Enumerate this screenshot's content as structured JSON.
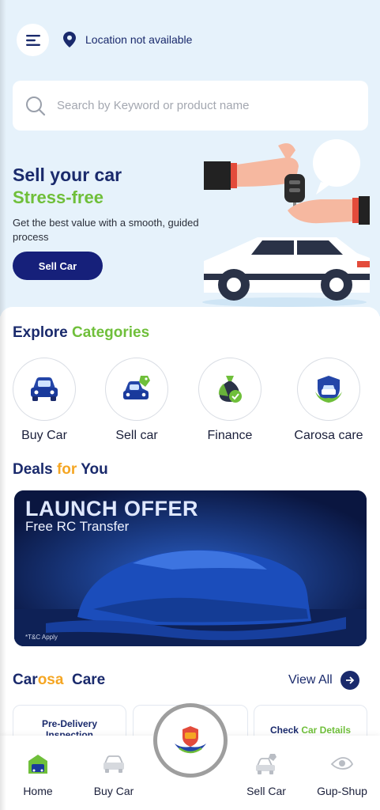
{
  "header": {
    "location_text": "Location not available"
  },
  "search": {
    "placeholder": "Search by Keyword or product name"
  },
  "hero": {
    "title_line1": "Sell your car",
    "title_line2": "Stress-free",
    "description": "Get the best value with a smooth, guided process",
    "button_label": "Sell Car"
  },
  "explore": {
    "title_part1": "Explore",
    "title_part2": "Categories",
    "categories": [
      {
        "label": "Buy Car",
        "icon": "car-front-icon"
      },
      {
        "label": "Sell car",
        "icon": "car-tag-icon"
      },
      {
        "label": "Finance",
        "icon": "money-bag-icon"
      },
      {
        "label": "Carosa care",
        "icon": "car-shield-icon"
      }
    ]
  },
  "deals": {
    "title_part1": "Deals",
    "title_part2": "for",
    "title_part3": "You",
    "banner_title": "LAUNCH OFFER",
    "banner_subtitle": "Free RC Transfer",
    "banner_tc": "*T&C Apply"
  },
  "care": {
    "title_part1": "Car",
    "title_part2": "osa",
    "title_part3": "Care",
    "view_all": "View All",
    "cards": [
      {
        "line1": "Pre-Delivery",
        "line2": "Inspection"
      },
      {
        "line1": "",
        "line2": ""
      },
      {
        "line1a": "Check",
        "line1b": "Car Details"
      }
    ]
  },
  "bottom_nav": {
    "items": [
      {
        "label": "Home",
        "icon": "home-icon",
        "active": true
      },
      {
        "label": "Buy Car",
        "icon": "car-icon"
      },
      {
        "label": "Sell Car",
        "icon": "sell-car-icon"
      },
      {
        "label": "Gup-Shup",
        "icon": "eye-icon"
      }
    ]
  },
  "colors": {
    "navy": "#1a2a6c",
    "green": "#6fbf3a",
    "hero_bg": "#e6f2fb",
    "button": "#16207a"
  }
}
